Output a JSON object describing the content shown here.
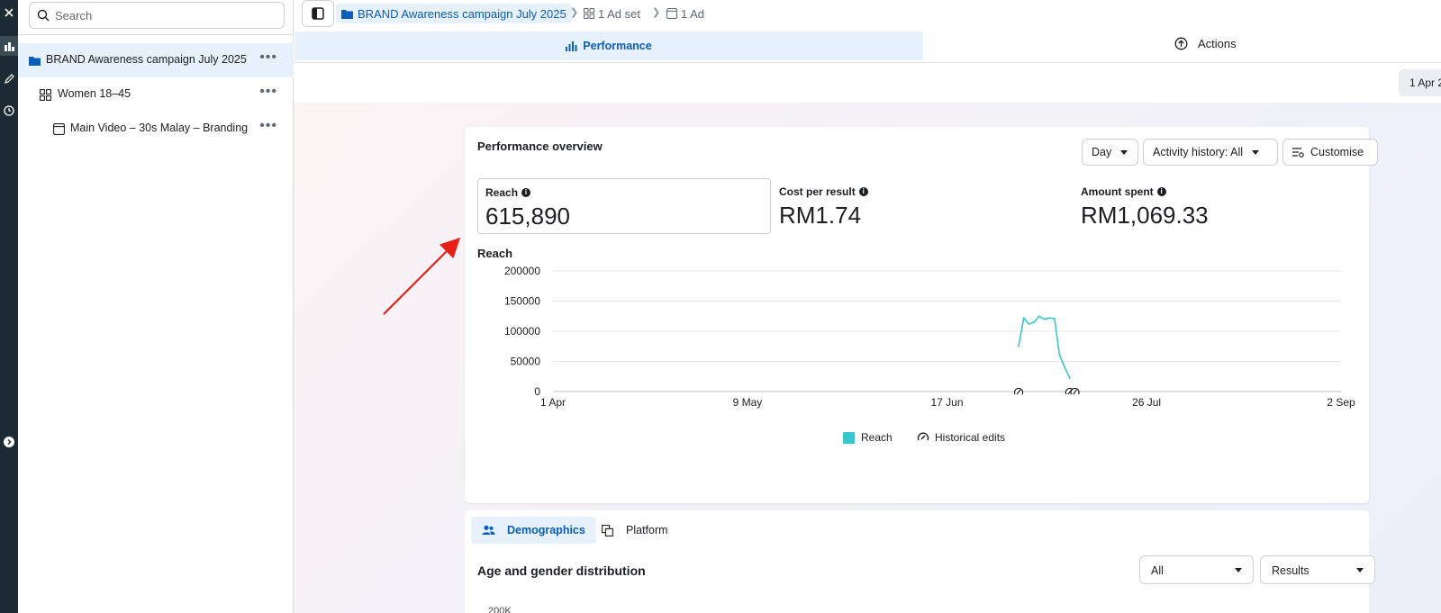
{
  "sidebar": {
    "search_placeholder": "Search",
    "items": [
      {
        "label": "BRAND Awareness campaign July 2025",
        "more": "•••"
      },
      {
        "label": "Women 18–45",
        "more": "•••"
      },
      {
        "label": "Main Video – 30s Malay – Branding",
        "more": "•••"
      }
    ]
  },
  "breadcrumb": {
    "campaign": "BRAND Awareness campaign July 2025",
    "adset": "1 Ad set",
    "ad": "1 Ad"
  },
  "tabs": {
    "performance": "Performance",
    "actions": "Actions"
  },
  "date_range_partial": "1 Apr 2",
  "overview": {
    "title": "Performance overview",
    "day_button": "Day",
    "activity_button": "Activity history: All",
    "customise_button": "Customise",
    "metrics": [
      {
        "label": "Reach",
        "value": "615,890"
      },
      {
        "label": "Cost per result",
        "value": "RM1.74"
      },
      {
        "label": "Amount spent",
        "value": "RM1,069.33"
      }
    ],
    "chart_title": "Reach"
  },
  "chart_data": {
    "type": "line",
    "title": "Reach",
    "x_tick_labels": [
      "1 Apr",
      "9 May",
      "17 Jun",
      "26 Jul",
      "2 Sep"
    ],
    "y_tick_labels": [
      "200000",
      "150000",
      "100000",
      "50000",
      "0"
    ],
    "ylim": [
      0,
      200000
    ],
    "series": [
      {
        "name": "Reach",
        "color": "#38c7ca",
        "x": [
          "2025-07-01",
          "2025-07-02",
          "2025-07-03",
          "2025-07-04",
          "2025-07-05",
          "2025-07-06",
          "2025-07-07",
          "2025-07-08",
          "2025-07-09",
          "2025-07-10",
          "2025-07-11"
        ],
        "values": [
          75000,
          122000,
          112000,
          115000,
          125000,
          120000,
          122000,
          121000,
          60000,
          40000,
          22000
        ]
      }
    ],
    "historical_edits_dates": [
      "2025-07-01",
      "2025-07-11",
      "2025-07-12"
    ],
    "legend": [
      "Reach",
      "Historical edits"
    ],
    "legend_position": "bottom",
    "grid": true
  },
  "breakdown": {
    "tabs": [
      "Demographics",
      "Platform"
    ],
    "section_title": "Age and gender distribution",
    "filter_all": "All",
    "filter_results": "Results",
    "partial_tick": "200K"
  },
  "colors": {
    "accent": "#0a5db9",
    "reach_line": "#38c7ca",
    "annotation_arrow": "#e8201c"
  }
}
